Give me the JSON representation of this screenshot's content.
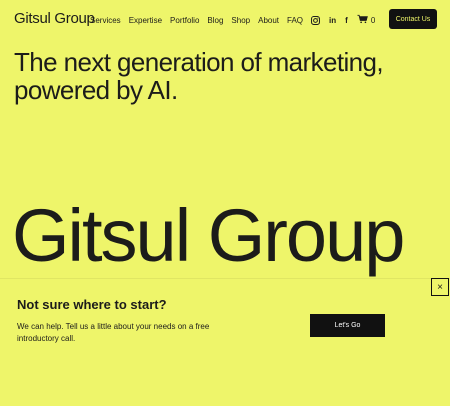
{
  "header": {
    "logo": "Gitsul Group",
    "nav": [
      "Services",
      "Expertise",
      "Portfolio",
      "Blog",
      "Shop",
      "About",
      "FAQ"
    ],
    "icons": [
      "instagram-icon",
      "linkedin-icon",
      "facebook-icon",
      "cart-icon"
    ],
    "linkedin_text": "in",
    "facebook_text": "f",
    "cart_count": "0",
    "cta": "Contact Us"
  },
  "hero": {
    "headline": "The next generation of marketing, powered by AI.",
    "big_title": "Gitsul Group"
  },
  "banner": {
    "title": "Not sure where to start?",
    "text": "We can help. Tell us a little about your needs on a free introductory call.",
    "button": "Let's Go",
    "close": "×"
  },
  "colors": {
    "background": "#eef56a",
    "dark": "#111111"
  }
}
